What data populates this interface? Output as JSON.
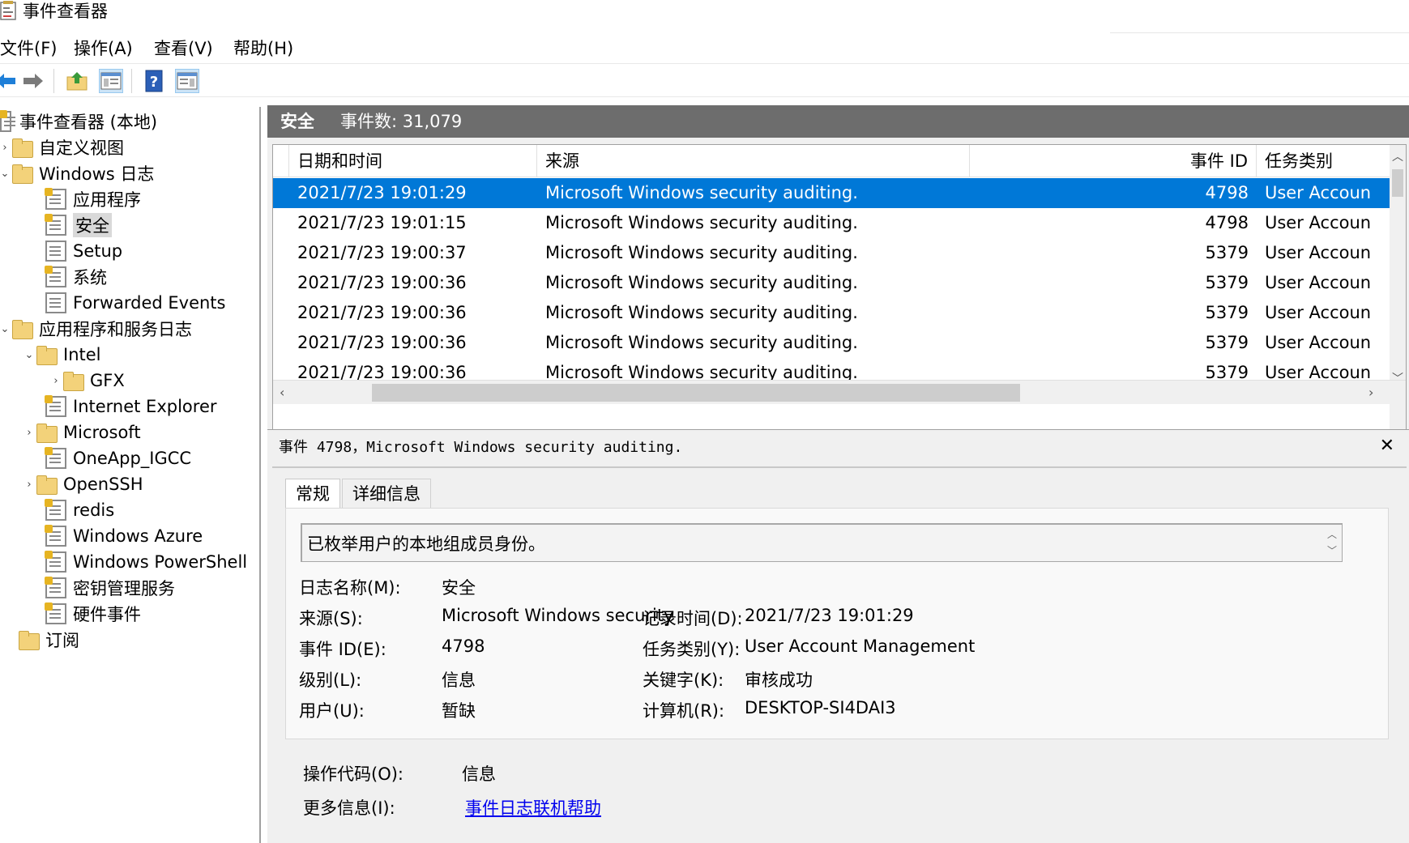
{
  "window": {
    "title": "事件查看器"
  },
  "menu": {
    "items": [
      "文件(F)",
      "操作(A)",
      "查看(V)",
      "帮助(H)"
    ]
  },
  "tree": {
    "items": [
      {
        "label": "事件查看器 (本地)",
        "icon": "event-viewer-icon"
      },
      {
        "label": "自定义视图",
        "icon": "folder-icon"
      },
      {
        "label": "Windows 日志",
        "icon": "folder-icon"
      },
      {
        "label": "应用程序",
        "icon": "log-icon"
      },
      {
        "label": "安全",
        "icon": "log-icon"
      },
      {
        "label": "Setup",
        "icon": "log-icon"
      },
      {
        "label": "系统",
        "icon": "log-icon"
      },
      {
        "label": "Forwarded Events",
        "icon": "log-icon"
      },
      {
        "label": "应用程序和服务日志",
        "icon": "folder-icon"
      },
      {
        "label": "Intel",
        "icon": "folder-icon"
      },
      {
        "label": "GFX",
        "icon": "folder-icon"
      },
      {
        "label": "Internet Explorer",
        "icon": "log-icon"
      },
      {
        "label": "Microsoft",
        "icon": "folder-icon"
      },
      {
        "label": "OneApp_IGCC",
        "icon": "log-icon"
      },
      {
        "label": "OpenSSH",
        "icon": "folder-icon"
      },
      {
        "label": "redis",
        "icon": "log-icon"
      },
      {
        "label": "Windows Azure",
        "icon": "log-icon"
      },
      {
        "label": "Windows PowerShell",
        "icon": "log-icon"
      },
      {
        "label": "密钥管理服务",
        "icon": "log-icon"
      },
      {
        "label": "硬件事件",
        "icon": "log-icon"
      },
      {
        "label": "订阅",
        "icon": "subscription-icon"
      }
    ]
  },
  "header": {
    "log_name": "安全",
    "count": "事件数: 31,079"
  },
  "grid": {
    "columns": [
      "日期和时间",
      "来源",
      "事件 ID",
      "任务类别"
    ],
    "rows": [
      {
        "datetime": "2021/7/23 19:01:29",
        "source": "Microsoft Windows security auditing.",
        "event_id": "4798",
        "category": "User Accoun"
      },
      {
        "datetime": "2021/7/23 19:01:15",
        "source": "Microsoft Windows security auditing.",
        "event_id": "4798",
        "category": "User Accoun"
      },
      {
        "datetime": "2021/7/23 19:00:37",
        "source": "Microsoft Windows security auditing.",
        "event_id": "5379",
        "category": "User Accoun"
      },
      {
        "datetime": "2021/7/23 19:00:36",
        "source": "Microsoft Windows security auditing.",
        "event_id": "5379",
        "category": "User Accoun"
      },
      {
        "datetime": "2021/7/23 19:00:36",
        "source": "Microsoft Windows security auditing.",
        "event_id": "5379",
        "category": "User Accoun"
      },
      {
        "datetime": "2021/7/23 19:00:36",
        "source": "Microsoft Windows security auditing.",
        "event_id": "5379",
        "category": "User Accoun"
      },
      {
        "datetime": "2021/7/23 19:00:36",
        "source": "Microsoft Windows security auditing.",
        "event_id": "5379",
        "category": "User Accoun"
      }
    ]
  },
  "detail": {
    "title": "事件 4798，Microsoft Windows security auditing.",
    "close": "✕",
    "tabs": [
      "常规",
      "详细信息"
    ],
    "description": "已枚举用户的本地组成员身份。",
    "labels": {
      "log_name": "日志名称(M):",
      "source": "来源(S):",
      "event_id": "事件 ID(E):",
      "level": "级别(L):",
      "user": "用户(U):",
      "opcode": "操作代码(O):",
      "more_info": "更多信息(I):",
      "logged": "记录时间(D):",
      "task_category": "任务类别(Y):",
      "keywords": "关键字(K):",
      "computer": "计算机(R):"
    },
    "values": {
      "log_name": "安全",
      "source": "Microsoft Windows security",
      "event_id": "4798",
      "level": "信息",
      "user": "暂缺",
      "opcode": "信息",
      "more_info": "事件日志联机帮助",
      "logged": "2021/7/23 19:01:29",
      "task_category": "User Account Management",
      "keywords": "审核成功",
      "computer": "DESKTOP-SI4DAI3"
    }
  },
  "colors": {
    "selection": "#0078d7",
    "header_band": "#6d6d6d",
    "link": "#0000ee"
  }
}
